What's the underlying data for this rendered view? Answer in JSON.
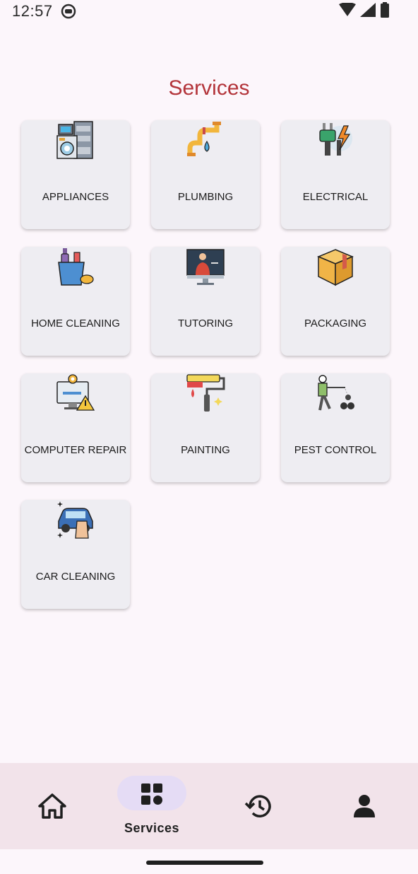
{
  "status_bar": {
    "time": "12:57"
  },
  "page_title": "Services",
  "services": [
    {
      "label": "APPLIANCES",
      "icon": "washing-machine-icon"
    },
    {
      "label": "PLUMBING",
      "icon": "pipe-leak-icon"
    },
    {
      "label": "ELECTRICAL",
      "icon": "plug-lightning-icon"
    },
    {
      "label": "HOME CLEANING",
      "icon": "cleaning-bucket-icon"
    },
    {
      "label": "TUTORING",
      "icon": "teacher-screen-icon"
    },
    {
      "label": "PACKAGING",
      "icon": "box-icon"
    },
    {
      "label": "COMPUTER REPAIR",
      "icon": "computer-repair-icon"
    },
    {
      "label": "PAINTING",
      "icon": "paint-roller-icon"
    },
    {
      "label": "PEST CONTROL",
      "icon": "pest-spray-icon"
    },
    {
      "label": "CAR CLEANING",
      "icon": "car-wash-icon"
    }
  ],
  "bottom_nav": {
    "items": [
      {
        "id": "home",
        "icon": "home-icon",
        "label": ""
      },
      {
        "id": "services",
        "icon": "grid-icon",
        "label": "Services",
        "selected": true
      },
      {
        "id": "history",
        "icon": "history-icon",
        "label": ""
      },
      {
        "id": "profile",
        "icon": "person-icon",
        "label": ""
      }
    ]
  },
  "colors": {
    "title": "#b3343a",
    "card_bg": "#eeedf2",
    "nav_bg": "#f2e3ea",
    "nav_pill": "#e5dcf5"
  }
}
